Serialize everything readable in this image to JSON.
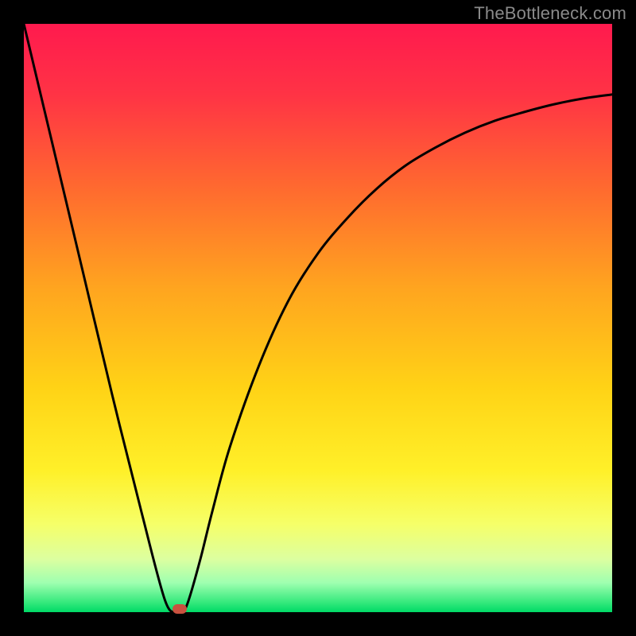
{
  "watermark": "TheBottleneck.com",
  "chart_data": {
    "type": "line",
    "title": "",
    "xlabel": "",
    "ylabel": "",
    "xlim": [
      0,
      100
    ],
    "ylim": [
      0,
      100
    ],
    "background_gradient": {
      "stops": [
        {
          "pos": 0.0,
          "color": "#ff1a4e"
        },
        {
          "pos": 0.12,
          "color": "#ff3345"
        },
        {
          "pos": 0.28,
          "color": "#ff6a2f"
        },
        {
          "pos": 0.45,
          "color": "#ffa51f"
        },
        {
          "pos": 0.62,
          "color": "#ffd316"
        },
        {
          "pos": 0.76,
          "color": "#fff029"
        },
        {
          "pos": 0.85,
          "color": "#f6ff68"
        },
        {
          "pos": 0.91,
          "color": "#dcffa0"
        },
        {
          "pos": 0.95,
          "color": "#9fffb0"
        },
        {
          "pos": 0.985,
          "color": "#30e87a"
        },
        {
          "pos": 1.0,
          "color": "#00d966"
        }
      ]
    },
    "series": [
      {
        "name": "bottleneck-curve",
        "x": [
          0,
          5,
          10,
          15,
          20,
          24,
          26,
          27,
          28,
          30,
          32,
          35,
          40,
          45,
          50,
          55,
          60,
          65,
          70,
          75,
          80,
          85,
          90,
          95,
          100
        ],
        "y": [
          100,
          79,
          58,
          37,
          17,
          2,
          0,
          0,
          2,
          9,
          17,
          28,
          42,
          53,
          61,
          67,
          72,
          76,
          79,
          81.5,
          83.5,
          85,
          86.3,
          87.3,
          88
        ]
      }
    ],
    "marker": {
      "x": 26.5,
      "y": 0.5,
      "color": "#c9513f"
    }
  }
}
